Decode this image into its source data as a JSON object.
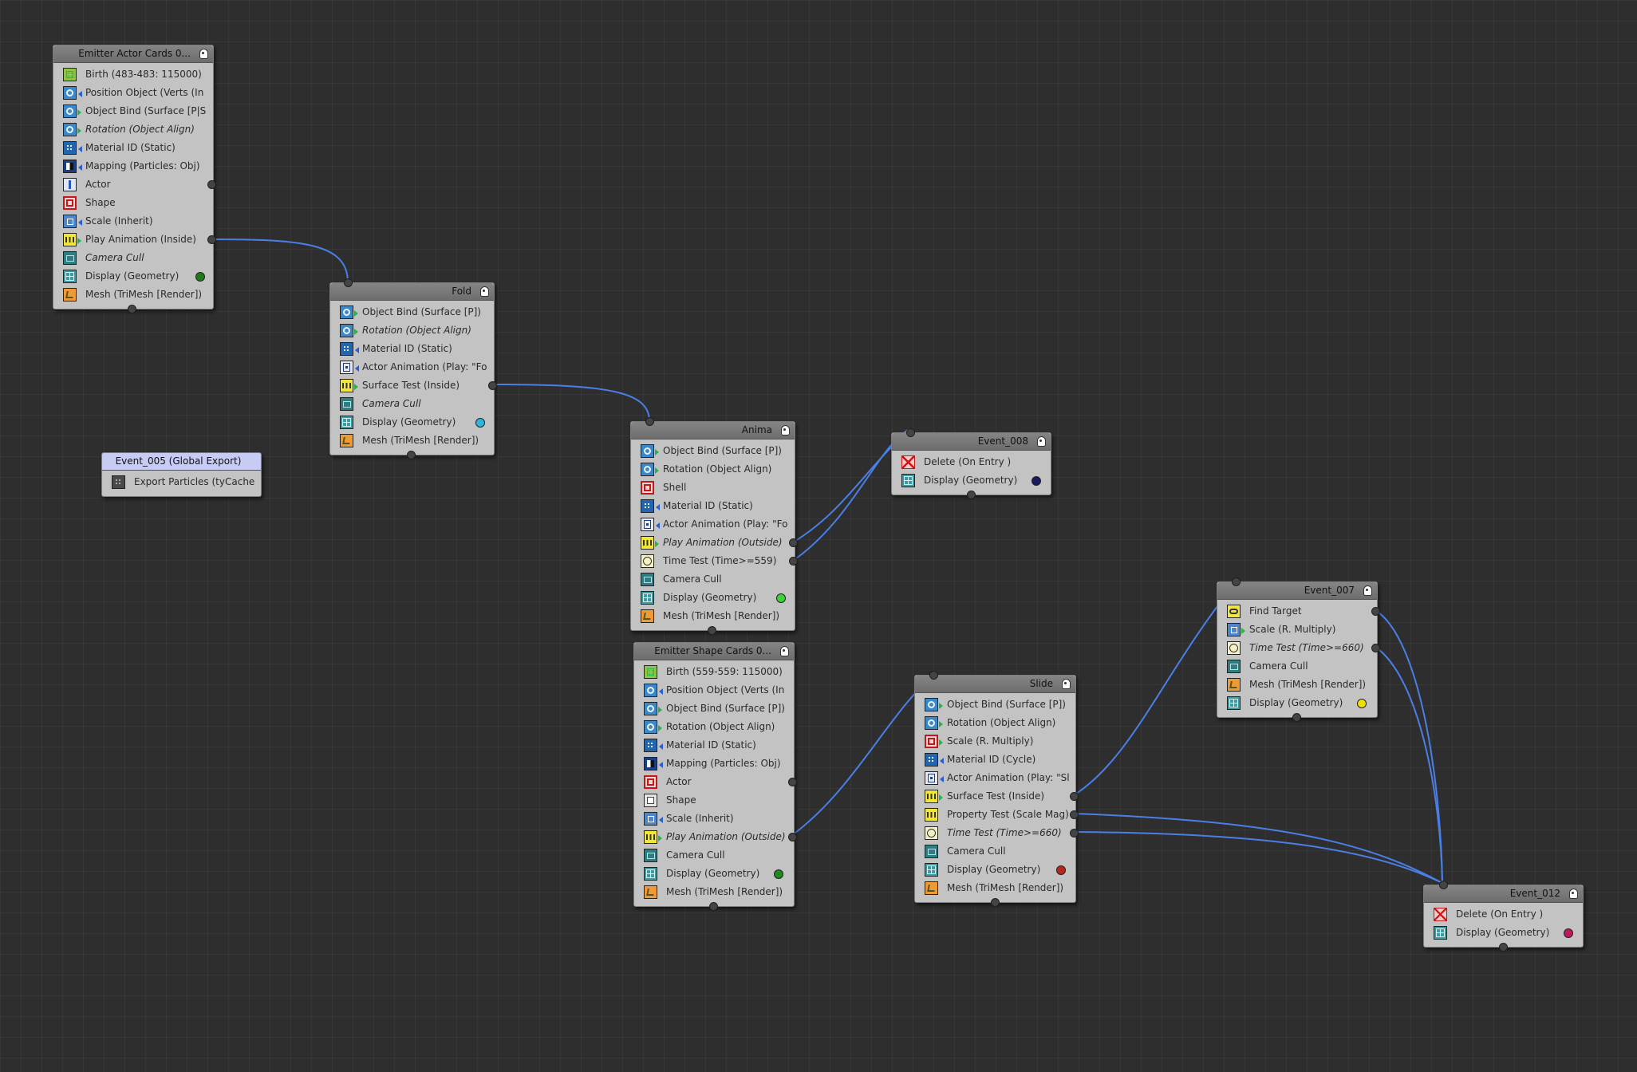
{
  "nodes": {
    "emitter_actor": {
      "title": "Emitter Actor Cards 0...",
      "ops": [
        {
          "label": "Birth (483-483: 115000)",
          "icon": "birth-icon"
        },
        {
          "label": "Position Object (Verts (In O...",
          "icon": "position-object-icon"
        },
        {
          "label": "Object Bind (Surface [P|S])",
          "icon": "object-bind-icon"
        },
        {
          "label": "Rotation (Object Align)",
          "icon": "rotation-icon"
        },
        {
          "label": "Material ID (Static)",
          "icon": "material-id-icon"
        },
        {
          "label": "Mapping (Particles: Obj)",
          "icon": "mapping-icon"
        },
        {
          "label": "Actor",
          "icon": "actor-icon"
        },
        {
          "label": "Shape",
          "icon": "shape-icon"
        },
        {
          "label": "Scale (Inherit)",
          "icon": "scale-icon"
        },
        {
          "label": "Play Animation (Inside)",
          "icon": "play-animation-icon"
        },
        {
          "label": "Camera Cull",
          "icon": "camera-cull-icon"
        },
        {
          "label": "Display (Geometry)",
          "icon": "display-icon"
        },
        {
          "label": "Mesh (TriMesh [Render])",
          "icon": "mesh-icon"
        }
      ],
      "display_color": "#1f7a1f"
    },
    "fold": {
      "title": "Fold",
      "ops": [
        {
          "label": "Object Bind (Surface [P])",
          "icon": "object-bind-icon"
        },
        {
          "label": "Rotation (Object Align)",
          "icon": "rotation-icon"
        },
        {
          "label": "Material ID (Static)",
          "icon": "material-id-icon"
        },
        {
          "label": "Actor Animation (Play: \"Fol...",
          "icon": "actor-animation-icon"
        },
        {
          "label": "Surface Test (Inside)",
          "icon": "surface-test-icon"
        },
        {
          "label": "Camera Cull",
          "icon": "camera-cull-icon"
        },
        {
          "label": "Display (Geometry)",
          "icon": "display-icon"
        },
        {
          "label": "Mesh (TriMesh [Render])",
          "icon": "mesh-icon"
        }
      ],
      "display_color": "#2fb6e0"
    },
    "event_005": {
      "title": "Event_005 (Global Export)",
      "ops": [
        {
          "label": "Export Particles (tyCache)",
          "icon": "export-particles-icon"
        }
      ]
    },
    "anima": {
      "title": "Anima",
      "ops": [
        {
          "label": "Object Bind (Surface [P])",
          "icon": "object-bind-icon"
        },
        {
          "label": "Rotation (Object Align)",
          "icon": "rotation-icon"
        },
        {
          "label": "Shell",
          "icon": "shell-icon"
        },
        {
          "label": "Material ID (Static)",
          "icon": "material-id-icon"
        },
        {
          "label": "Actor Animation (Play: \"Fol...",
          "icon": "actor-animation-icon"
        },
        {
          "label": "Play Animation (Outside)",
          "icon": "play-animation-icon"
        },
        {
          "label": "Time Test (Time>=559)",
          "icon": "time-test-icon"
        },
        {
          "label": "Camera Cull",
          "icon": "camera-cull-icon"
        },
        {
          "label": "Display (Geometry)",
          "icon": "display-icon"
        },
        {
          "label": "Mesh (TriMesh [Render])",
          "icon": "mesh-icon"
        }
      ],
      "display_color": "#3ad43a"
    },
    "event_008": {
      "title": "Event_008",
      "ops": [
        {
          "label": "Delete (On Entry )",
          "icon": "delete-icon"
        },
        {
          "label": "Display (Geometry)",
          "icon": "display-icon"
        }
      ],
      "display_color": "#1a1a5c"
    },
    "emitter_shape": {
      "title": "Emitter Shape Cards 0...",
      "ops": [
        {
          "label": "Birth (559-559: 115000)",
          "icon": "birth-icon"
        },
        {
          "label": "Position Object (Verts (In O...",
          "icon": "position-object-icon"
        },
        {
          "label": "Object Bind (Surface [P])",
          "icon": "object-bind-icon"
        },
        {
          "label": "Rotation (Object Align)",
          "icon": "rotation-icon"
        },
        {
          "label": "Material ID (Static)",
          "icon": "material-id-icon"
        },
        {
          "label": "Mapping (Particles: Obj)",
          "icon": "mapping-icon"
        },
        {
          "label": "Actor",
          "icon": "actor-icon"
        },
        {
          "label": "Shape",
          "icon": "shape-icon"
        },
        {
          "label": "Scale (Inherit)",
          "icon": "scale-icon"
        },
        {
          "label": "Play Animation (Outside)",
          "icon": "play-animation-icon"
        },
        {
          "label": "Camera Cull",
          "icon": "camera-cull-icon"
        },
        {
          "label": "Display (Geometry)",
          "icon": "display-icon"
        },
        {
          "label": "Mesh (TriMesh [Render])",
          "icon": "mesh-icon"
        }
      ],
      "display_color": "#1f8a1f"
    },
    "slide": {
      "title": "Slide",
      "ops": [
        {
          "label": "Object Bind (Surface [P])",
          "icon": "object-bind-icon"
        },
        {
          "label": "Rotation (Object Align)",
          "icon": "rotation-icon"
        },
        {
          "label": "Scale (R. Multiply)",
          "icon": "scale-icon"
        },
        {
          "label": "Material ID (Cycle)",
          "icon": "material-id-icon"
        },
        {
          "label": "Actor Animation (Play: \"Sli...",
          "icon": "actor-animation-icon"
        },
        {
          "label": "Surface Test (Inside)",
          "icon": "surface-test-icon"
        },
        {
          "label": "Property Test (Scale Mag)",
          "icon": "property-test-icon"
        },
        {
          "label": "Time Test (Time>=660)",
          "icon": "time-test-icon"
        },
        {
          "label": "Camera Cull",
          "icon": "camera-cull-icon"
        },
        {
          "label": "Display (Geometry)",
          "icon": "display-icon"
        },
        {
          "label": "Mesh (TriMesh [Render])",
          "icon": "mesh-icon"
        }
      ],
      "display_color": "#b8281e"
    },
    "event_007": {
      "title": "Event_007",
      "ops": [
        {
          "label": "Find Target",
          "icon": "find-target-icon"
        },
        {
          "label": "Scale (R. Multiply)",
          "icon": "scale-icon"
        },
        {
          "label": "Time Test (Time>=660)",
          "icon": "time-test-icon"
        },
        {
          "label": "Camera Cull",
          "icon": "camera-cull-icon"
        },
        {
          "label": "Mesh (TriMesh [Render])",
          "icon": "mesh-icon"
        },
        {
          "label": "Display (Geometry)",
          "icon": "display-icon"
        }
      ],
      "display_color": "#f0e000"
    },
    "event_012": {
      "title": "Event_012",
      "ops": [
        {
          "label": "Delete (On Entry )",
          "icon": "delete-icon"
        },
        {
          "label": "Display (Geometry)",
          "icon": "display-icon"
        }
      ],
      "display_color": "#c0185a"
    }
  },
  "colors": {
    "background": "#2e2e2e",
    "node_body": "#c3c3c3",
    "node_header": "#7a7a7a",
    "wire": "#4a7fe6",
    "global_header": "#c8ccf4"
  }
}
